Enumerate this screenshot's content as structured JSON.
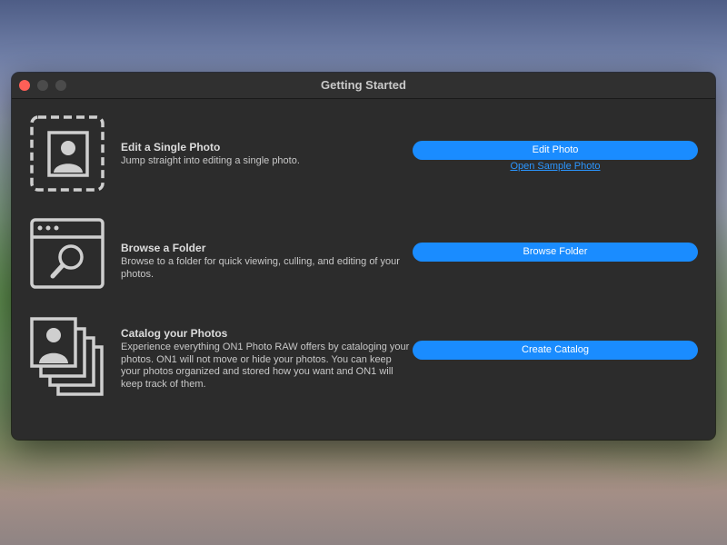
{
  "window": {
    "title": "Getting Started"
  },
  "sections": [
    {
      "heading": "Edit a Single Photo",
      "description": "Jump straight into editing a single photo.",
      "button_label": "Edit Photo",
      "link_label": "Open Sample Photo",
      "icon": "single-photo-icon"
    },
    {
      "heading": "Browse a Folder",
      "description": "Browse to a folder for quick viewing, culling, and editing of your photos.",
      "button_label": "Browse Folder",
      "icon": "browse-folder-icon"
    },
    {
      "heading": "Catalog your Photos",
      "description": "Experience everything ON1 Photo RAW offers by cataloging your photos. ON1 will not move or hide your photos. You can keep your photos organized and stored how you want and ON1 will keep track of them.",
      "button_label": "Create Catalog",
      "icon": "catalog-photos-icon"
    }
  ],
  "colors": {
    "accent": "#1a8cff",
    "window_bg": "#2c2c2c",
    "close": "#fe5f57"
  }
}
